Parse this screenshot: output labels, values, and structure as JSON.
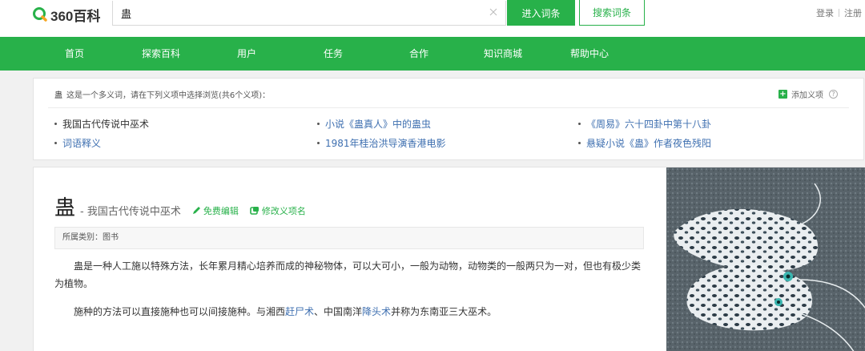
{
  "header": {
    "logo_text": "360百科",
    "search_value": "蛊",
    "enter_label": "进入词条",
    "search_label": "搜索词条",
    "login_label": "登录",
    "register_label": "注册"
  },
  "nav": {
    "items": [
      {
        "label": "首页"
      },
      {
        "label": "探索百科"
      },
      {
        "label": "用户"
      },
      {
        "label": "任务"
      },
      {
        "label": "合作"
      },
      {
        "label": "知识商城"
      },
      {
        "label": "帮助中心"
      }
    ]
  },
  "disambiguation": {
    "keyword": "蛊",
    "intro": "这是一个多义词，请在下列义项中选择浏览(共6个义项)：",
    "add_label": "添加义项",
    "help_glyph": "?",
    "senses": [
      {
        "label": "我国古代传说中巫术"
      },
      {
        "label": "小说《蛊真人》中的蛊虫"
      },
      {
        "label": "《周易》六十四卦中第十八卦"
      },
      {
        "label": "词语释义"
      },
      {
        "label": "1981年桂治洪导演香港电影"
      },
      {
        "label": "悬疑小说《蛊》作者夜色残阳"
      }
    ]
  },
  "article": {
    "title": "蛊",
    "subtitle": "- 我国古代传说中巫术",
    "free_edit_label": "免费编辑",
    "rename_label": "修改义项名",
    "category": "所属类别：图书",
    "para1": "蛊是一种人工施以特殊方法，长年累月精心培养而成的神秘物体，可以大可小，一般为动物，动物类的一般两只为一对，但也有极少类为植物。",
    "para2": {
      "t1": "施种的方法可以直接施种也可以间接施种。与湘西",
      "link1": "赶尸术",
      "t2": "、中国南洋",
      "link2": "降头术",
      "t3": "并称为东南亚三大巫术。"
    }
  },
  "icons": {
    "logo": "360-logo-icon",
    "clear": "close-icon",
    "add": "plus-icon",
    "help": "help-icon",
    "edit": "pencil-icon",
    "rename": "rename-icon"
  },
  "colors": {
    "brand_green": "#28b14a",
    "link_blue": "#3e6fb0"
  }
}
